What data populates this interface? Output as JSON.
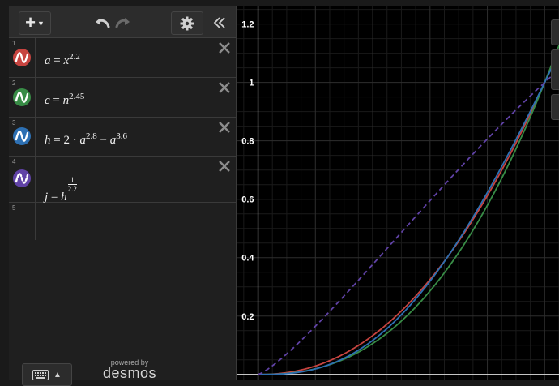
{
  "toolbar": {
    "add_icon": "plus-icon",
    "undo_icon": "undo-icon",
    "redo_icon": "redo-icon",
    "settings_icon": "gear-icon",
    "collapse_icon": "double-chevron-left-icon"
  },
  "expressions": [
    {
      "num": "1",
      "color": "#c74440",
      "lhs": "a",
      "base": "x",
      "exp": "2.2"
    },
    {
      "num": "2",
      "color": "#388c46",
      "lhs": "c",
      "base": "n",
      "exp": "2.45"
    },
    {
      "num": "3",
      "color": "#2d70b3",
      "lhs": "h",
      "coef": "2",
      "base": "a",
      "exp": "2.8",
      "base2": "a",
      "exp2": "3.6"
    },
    {
      "num": "4",
      "color": "#6042a6",
      "lhs": "j",
      "base": "h",
      "frac_num": "1",
      "frac_den": "2.2"
    },
    {
      "num": "5"
    }
  ],
  "footer": {
    "powered_by": "powered by",
    "brand": "desmos"
  },
  "graph": {
    "x_ticks": [
      "0",
      "0.2",
      "0.4",
      "0.6",
      "0.8",
      "1"
    ],
    "y_ticks": [
      "0.2",
      "0.4",
      "0.6",
      "0.8",
      "1",
      "1.2"
    ],
    "xlim": [
      -0.075,
      1.05
    ],
    "ylim": [
      -0.02,
      1.26
    ],
    "background": "#000000",
    "grid_minor_color": "#1a1a1a",
    "grid_major_color": "#2e2e2e",
    "axis_color": "#ffffff"
  },
  "chart_data": {
    "type": "line",
    "x_range": [
      0,
      1.05
    ],
    "series": [
      {
        "color": "#c74440",
        "expr": "x^2.2"
      },
      {
        "color": "#388c46",
        "expr": "x^2.45"
      },
      {
        "color": "#2d70b3",
        "expr": "2*x^2.8 - x^3.6"
      },
      {
        "color": "#6042a6",
        "expr": "(2*x^2.8 - x^3.6)^(1/2.2)",
        "dashed": true
      }
    ]
  }
}
